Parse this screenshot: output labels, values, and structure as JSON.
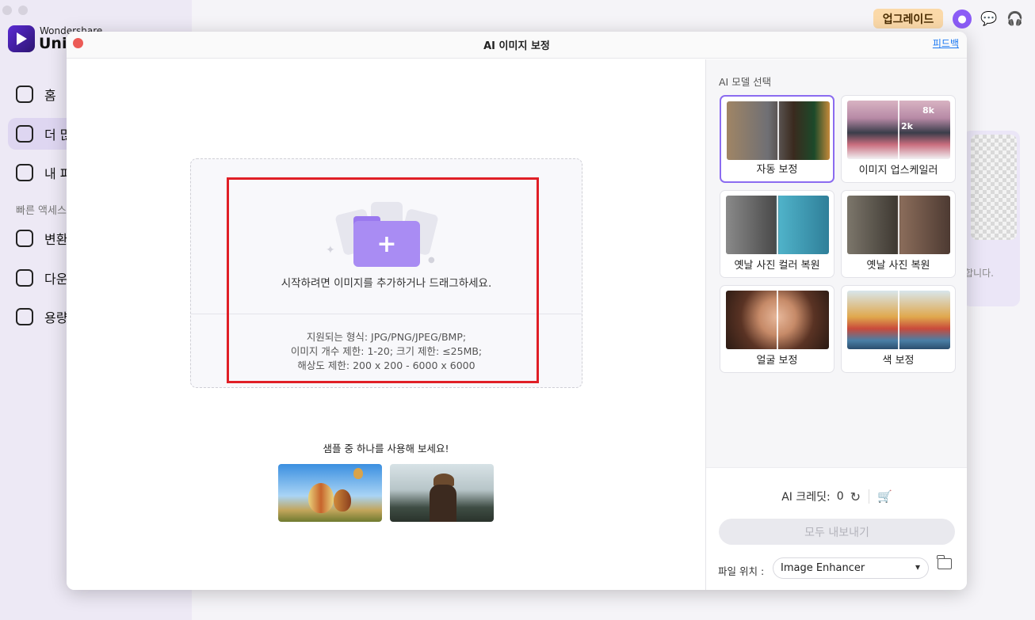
{
  "app": {
    "brand_small": "Wondershare",
    "brand_big": "UniC",
    "nav": [
      {
        "label": "홈",
        "icon": "home-icon"
      },
      {
        "label": "더 많",
        "icon": "toolbox-icon",
        "active": true
      },
      {
        "label": "내 파",
        "icon": "file-icon"
      }
    ],
    "quick_access_label": "빠른 액세스",
    "quick_items": [
      {
        "label": "변환",
        "icon": "convert-icon"
      },
      {
        "label": "다운",
        "icon": "download-icon"
      },
      {
        "label": "용량",
        "icon": "compress-icon"
      }
    ],
    "upgrade_label": "업그레이드",
    "behind_text": "합니다."
  },
  "modal": {
    "title": "AI 이미지 보정",
    "feedback_label": "피드백",
    "drop_text": "시작하려면 이미지를 추가하거나 드래그하세요.",
    "specs": [
      "지원되는 형식: JPG/PNG/JPEG/BMP;",
      "이미지 개수 제한: 1-20; 크기 제한: ≤25MB;",
      "해상도 제한: 200 x 200 - 6000 x 6000"
    ],
    "sample_title": "샘플 중 하나를 사용해 보세요!",
    "model_heading": "AI 모델 선택",
    "models": [
      {
        "label": "자동 보정",
        "selected": true
      },
      {
        "label": "이미지 업스케일러",
        "badge_8k": "8k",
        "badge_2k": "2k"
      },
      {
        "label": "옛날 사진 컬러 복원"
      },
      {
        "label": "옛날 사진 복원"
      },
      {
        "label": "얼굴 보정"
      },
      {
        "label": "색 보정"
      }
    ],
    "credits_label": "AI 크레딧:",
    "credits_value": "0",
    "export_label": "모두 내보내기",
    "location_label": "파일 위치 :",
    "location_value": "Image Enhancer"
  },
  "colors": {
    "accent": "#8b6cf0",
    "highlight": "#e01f26",
    "close": "#ec5b56",
    "upgrade_bg": "#fbd9a9"
  }
}
